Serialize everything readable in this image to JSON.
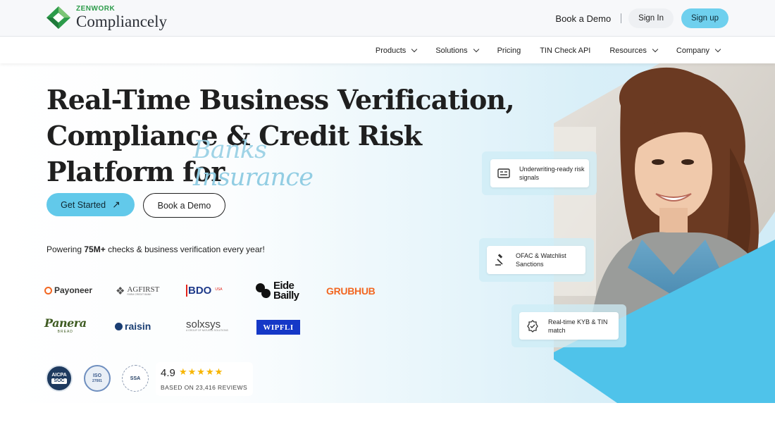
{
  "header": {
    "logo_small": "ZENWORK",
    "logo_big": "Compliancely",
    "book_demo": "Book a Demo",
    "sign_in": "Sign In",
    "sign_up": "Sign up"
  },
  "nav": {
    "products": "Products",
    "solutions": "Solutions",
    "pricing": "Pricing",
    "tin_check_api": "TIN Check API",
    "resources": "Resources",
    "company": "Company"
  },
  "hero": {
    "line1": "Real-Time Business Verification,",
    "line2": "Compliance & Credit Risk",
    "line3": "Platform for",
    "rotating_1": "Banks",
    "rotating_2": "Insurance",
    "get_started": "Get Started",
    "book_demo": "Book a Demo",
    "powering_prefix": "Powering ",
    "powering_bold": "75M+",
    "powering_suffix": " checks & business verification every year!"
  },
  "logos": {
    "payoneer": "Payoneer",
    "agfirst": "AGFIRST",
    "agfirst_sub": "FARM CREDIT BANK",
    "bdo": "BDO",
    "bdo_usa": "USA",
    "eide_1": "Eide",
    "eide_2": "Bailly",
    "grubhub": "GRUBHUB",
    "panera": "Panera",
    "panera_sub": "BREAD",
    "raisin": "raisin",
    "solxsys": "solxsys",
    "solxsys_sub": "A GROUP OF NATURAL SOLUTIONS",
    "wipfli": "WIPFLI"
  },
  "badges": {
    "aicpa": "AICPA",
    "soc": "SOC",
    "iso": "ISO",
    "iso_num": "27001",
    "ssa": "SSA"
  },
  "rating": {
    "score": "4.9",
    "stars": "★★★★★",
    "reviews": "BASED ON 23,416 REVIEWS"
  },
  "features": {
    "underwriting": "Underwriting-ready risk signals",
    "ofac": "OFAC & Watchlist Sanctions",
    "kyb": "Real-time KYB & TIN match"
  },
  "colors": {
    "accent": "#62c9ea",
    "brand_green": "#2c9b4a",
    "text_dark": "#1f1f1f",
    "grubhub_orange": "#f26722",
    "wipfli_blue": "#1538c7"
  }
}
